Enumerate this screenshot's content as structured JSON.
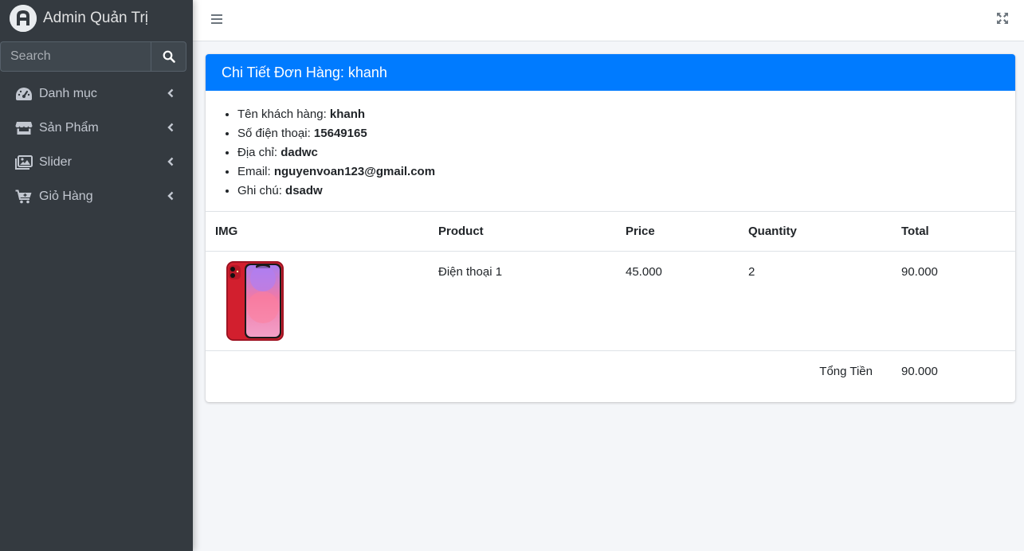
{
  "brand": {
    "name": "Admin Quản Trị"
  },
  "search": {
    "placeholder": "Search"
  },
  "sidebar": {
    "items": [
      {
        "label": "Danh mục",
        "icon": "dashboard-icon"
      },
      {
        "label": "Sản Phẩm",
        "icon": "store-icon"
      },
      {
        "label": "Slider",
        "icon": "images-icon"
      },
      {
        "label": "Giỏ Hàng",
        "icon": "cart-icon"
      }
    ]
  },
  "card": {
    "title": "Chi Tiết Đơn Hàng: khanh",
    "info": [
      {
        "label": "Tên khách hàng:",
        "value": "khanh"
      },
      {
        "label": "Số điện thoại:",
        "value": "15649165"
      },
      {
        "label": "Địa chỉ:",
        "value": "dadwc"
      },
      {
        "label": "Email:",
        "value": "nguyenvoan123@gmail.com"
      },
      {
        "label": "Ghi chú:",
        "value": "dsadw"
      }
    ]
  },
  "table": {
    "headers": [
      "IMG",
      "Product",
      "Price",
      "Quantity",
      "Total"
    ],
    "rows": [
      {
        "product": "Điện thoại 1",
        "price": "45.000",
        "quantity": "2",
        "total": "90.000"
      }
    ],
    "grand_total_label": "Tổng Tiền",
    "grand_total_value": "90.000"
  },
  "colors": {
    "sidebar": "#343a40",
    "accent": "#007bff",
    "background": "#f4f6f9"
  }
}
